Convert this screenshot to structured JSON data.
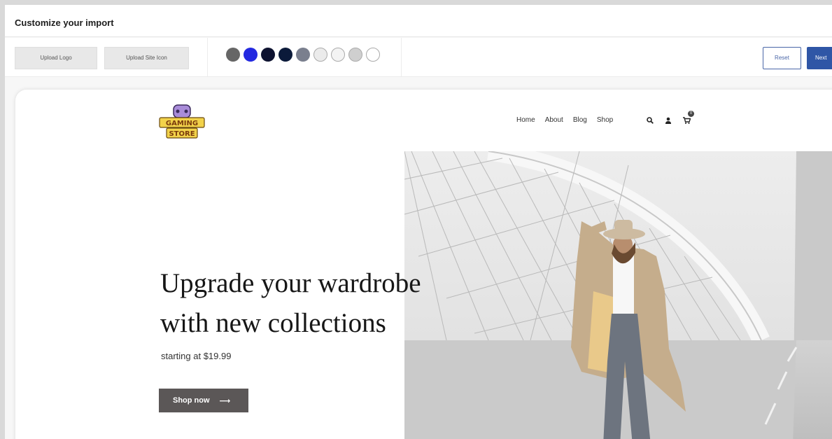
{
  "header": {
    "title": "Customize your import"
  },
  "toolbar": {
    "upload_logo_label": "Upload Logo",
    "upload_site_icon_label": "Upload Site Icon",
    "palette": [
      "#666666",
      "#2329e0",
      "#0d1230",
      "#0b1a3a",
      "#7a7f8e",
      "#ebebeb",
      "#f3f3f3",
      "#cfcfcf",
      "#ffffff"
    ],
    "reset_label": "Reset",
    "next_label": "Next"
  },
  "site": {
    "logo_text": "GAMING STORE",
    "nav": [
      "Home",
      "About",
      "Blog",
      "Shop"
    ],
    "icons": [
      "search-icon",
      "user-icon",
      "cart-icon"
    ],
    "cart_count": "0",
    "hero": {
      "headline_line1": "Upgrade your wardrobe",
      "headline_line2": "with new collections",
      "subline": "starting at $19.99",
      "cta_label": "Shop now",
      "cta_arrow": "⟶"
    }
  }
}
